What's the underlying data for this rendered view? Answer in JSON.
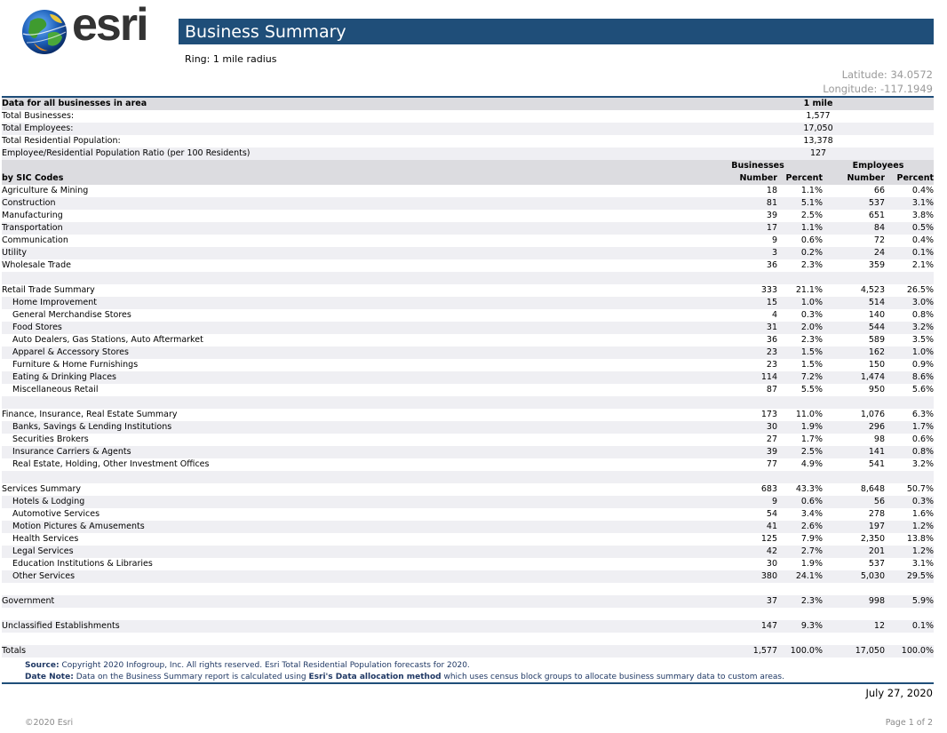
{
  "brand": {
    "logo_text": "esri"
  },
  "header": {
    "title": "Business Summary",
    "ring": "Ring: 1 mile radius",
    "latitude": "Latitude: 34.0572",
    "longitude": "Longitude: -117.1949"
  },
  "summary": {
    "heading": "Data for all businesses in area",
    "column": "1 mile",
    "rows": [
      {
        "label": "Total Businesses:",
        "value": "1,577"
      },
      {
        "label": "Total Employees:",
        "value": "17,050"
      },
      {
        "label": "Total Residential Population:",
        "value": "13,378"
      },
      {
        "label": "Employee/Residential Population Ratio (per 100 Residents)",
        "value": "127"
      }
    ]
  },
  "sic": {
    "heading": "by SIC Codes",
    "group_businesses": "Businesses",
    "group_employees": "Employees",
    "col_number": "Number",
    "col_percent": "Percent",
    "rows": [
      {
        "label": "Agriculture & Mining",
        "bn": "18",
        "bp": "1.1%",
        "en": "66",
        "ep": "0.4%"
      },
      {
        "label": "Construction",
        "bn": "81",
        "bp": "5.1%",
        "en": "537",
        "ep": "3.1%"
      },
      {
        "label": "Manufacturing",
        "bn": "39",
        "bp": "2.5%",
        "en": "651",
        "ep": "3.8%"
      },
      {
        "label": "Transportation",
        "bn": "17",
        "bp": "1.1%",
        "en": "84",
        "ep": "0.5%"
      },
      {
        "label": "Communication",
        "bn": "9",
        "bp": "0.6%",
        "en": "72",
        "ep": "0.4%"
      },
      {
        "label": "Utility",
        "bn": "3",
        "bp": "0.2%",
        "en": "24",
        "ep": "0.1%"
      },
      {
        "label": "Wholesale Trade",
        "bn": "36",
        "bp": "2.3%",
        "en": "359",
        "ep": "2.1%"
      },
      {
        "blank": true
      },
      {
        "label": "Retail Trade Summary",
        "bn": "333",
        "bp": "21.1%",
        "en": "4,523",
        "ep": "26.5%"
      },
      {
        "label": "Home Improvement",
        "sub": true,
        "bn": "15",
        "bp": "1.0%",
        "en": "514",
        "ep": "3.0%"
      },
      {
        "label": "General Merchandise Stores",
        "sub": true,
        "bn": "4",
        "bp": "0.3%",
        "en": "140",
        "ep": "0.8%"
      },
      {
        "label": "Food Stores",
        "sub": true,
        "bn": "31",
        "bp": "2.0%",
        "en": "544",
        "ep": "3.2%"
      },
      {
        "label": "Auto Dealers, Gas Stations, Auto Aftermarket",
        "sub": true,
        "bn": "36",
        "bp": "2.3%",
        "en": "589",
        "ep": "3.5%"
      },
      {
        "label": "Apparel & Accessory Stores",
        "sub": true,
        "bn": "23",
        "bp": "1.5%",
        "en": "162",
        "ep": "1.0%"
      },
      {
        "label": "Furniture & Home Furnishings",
        "sub": true,
        "bn": "23",
        "bp": "1.5%",
        "en": "150",
        "ep": "0.9%"
      },
      {
        "label": "Eating & Drinking Places",
        "sub": true,
        "bn": "114",
        "bp": "7.2%",
        "en": "1,474",
        "ep": "8.6%"
      },
      {
        "label": "Miscellaneous Retail",
        "sub": true,
        "bn": "87",
        "bp": "5.5%",
        "en": "950",
        "ep": "5.6%"
      },
      {
        "blank": true
      },
      {
        "label": "Finance, Insurance, Real Estate Summary",
        "bn": "173",
        "bp": "11.0%",
        "en": "1,076",
        "ep": "6.3%"
      },
      {
        "label": "Banks, Savings & Lending Institutions",
        "sub": true,
        "bn": "30",
        "bp": "1.9%",
        "en": "296",
        "ep": "1.7%"
      },
      {
        "label": "Securities Brokers",
        "sub": true,
        "bn": "27",
        "bp": "1.7%",
        "en": "98",
        "ep": "0.6%"
      },
      {
        "label": "Insurance Carriers & Agents",
        "sub": true,
        "bn": "39",
        "bp": "2.5%",
        "en": "141",
        "ep": "0.8%"
      },
      {
        "label": "Real Estate, Holding, Other Investment Offices",
        "sub": true,
        "bn": "77",
        "bp": "4.9%",
        "en": "541",
        "ep": "3.2%"
      },
      {
        "blank": true
      },
      {
        "label": "Services Summary",
        "bn": "683",
        "bp": "43.3%",
        "en": "8,648",
        "ep": "50.7%"
      },
      {
        "label": "Hotels & Lodging",
        "sub": true,
        "bn": "9",
        "bp": "0.6%",
        "en": "56",
        "ep": "0.3%"
      },
      {
        "label": "Automotive Services",
        "sub": true,
        "bn": "54",
        "bp": "3.4%",
        "en": "278",
        "ep": "1.6%"
      },
      {
        "label": "Motion Pictures & Amusements",
        "sub": true,
        "bn": "41",
        "bp": "2.6%",
        "en": "197",
        "ep": "1.2%"
      },
      {
        "label": "Health Services",
        "sub": true,
        "bn": "125",
        "bp": "7.9%",
        "en": "2,350",
        "ep": "13.8%"
      },
      {
        "label": "Legal Services",
        "sub": true,
        "bn": "42",
        "bp": "2.7%",
        "en": "201",
        "ep": "1.2%"
      },
      {
        "label": "Education Institutions & Libraries",
        "sub": true,
        "bn": "30",
        "bp": "1.9%",
        "en": "537",
        "ep": "3.1%"
      },
      {
        "label": "Other Services",
        "sub": true,
        "bn": "380",
        "bp": "24.1%",
        "en": "5,030",
        "ep": "29.5%"
      },
      {
        "blank": true
      },
      {
        "label": "Government",
        "bn": "37",
        "bp": "2.3%",
        "en": "998",
        "ep": "5.9%"
      },
      {
        "blank": true
      },
      {
        "label": "Unclassified Establishments",
        "bn": "147",
        "bp": "9.3%",
        "en": "12",
        "ep": "0.1%"
      },
      {
        "blank": true
      },
      {
        "label": "Totals",
        "bn": "1,577",
        "bp": "100.0%",
        "en": "17,050",
        "ep": "100.0%"
      }
    ]
  },
  "footer": {
    "source_label": "Source:",
    "source_text": "Copyright 2020 Infogroup, Inc. All rights reserved. Esri Total Residential Population forecasts for 2020.",
    "datenote_label": "Date Note:",
    "datenote_pre": "Data on the Business Summary report is calculated using",
    "datenote_link": "Esri's Data allocation method",
    "datenote_post": "which uses census block groups to allocate business summary data to custom areas.",
    "date": "July 27, 2020",
    "copyright": "©2020 Esri",
    "page": "Page 1 of 2"
  }
}
